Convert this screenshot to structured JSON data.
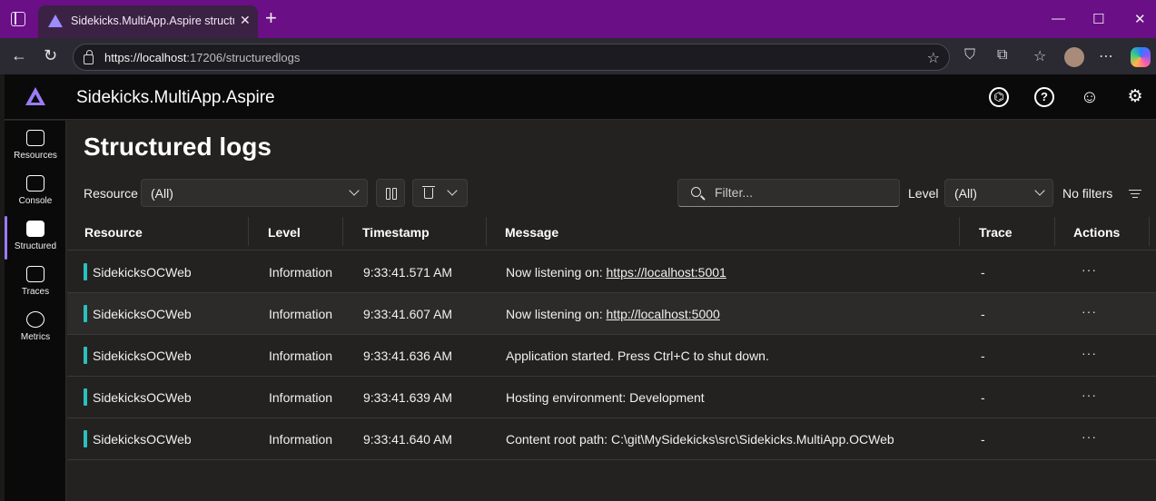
{
  "browser": {
    "tab_title": "Sidekicks.MultiApp.Aspire structured",
    "url_host": "https://localhost",
    "url_rest": ":17206/structuredlogs"
  },
  "app": {
    "title": "Sidekicks.MultiApp.Aspire",
    "accent": "#9a7cf6"
  },
  "nav": [
    {
      "label": "Resources",
      "icon": "resources-icon"
    },
    {
      "label": "Console",
      "icon": "console-icon"
    },
    {
      "label": "Structured",
      "icon": "structured-logs-icon"
    },
    {
      "label": "Traces",
      "icon": "traces-icon"
    },
    {
      "label": "Metrics",
      "icon": "metrics-icon"
    }
  ],
  "page": {
    "title": "Structured logs"
  },
  "toolbar": {
    "resource_label": "Resource",
    "resource_value": "(All)",
    "search_placeholder": "Filter...",
    "level_label": "Level",
    "level_value": "(All)",
    "no_filters": "No filters"
  },
  "table": {
    "columns": [
      "Resource",
      "Level",
      "Timestamp",
      "Message",
      "Trace",
      "Actions"
    ],
    "rows": [
      {
        "resource": "SidekicksOCWeb",
        "level": "Information",
        "timestamp": "9:33:41.571 AM",
        "message_prefix": "Now listening on: ",
        "message_link": "https://localhost:5001",
        "trace": "-"
      },
      {
        "resource": "SidekicksOCWeb",
        "level": "Information",
        "timestamp": "9:33:41.607 AM",
        "message_prefix": "Now listening on: ",
        "message_link": "http://localhost:5000",
        "trace": "-"
      },
      {
        "resource": "SidekicksOCWeb",
        "level": "Information",
        "timestamp": "9:33:41.636 AM",
        "message_prefix": "Application started. Press Ctrl+C to shut down.",
        "message_link": "",
        "trace": "-"
      },
      {
        "resource": "SidekicksOCWeb",
        "level": "Information",
        "timestamp": "9:33:41.639 AM",
        "message_prefix": "Hosting environment: Development",
        "message_link": "",
        "trace": "-"
      },
      {
        "resource": "SidekicksOCWeb",
        "level": "Information",
        "timestamp": "9:33:41.640 AM",
        "message_prefix": "Content root path: C:\\git\\MySidekicks\\src\\Sidekicks.MultiApp.OCWeb",
        "message_link": "",
        "trace": "-"
      }
    ],
    "resource_color": "#2bbfbf"
  }
}
